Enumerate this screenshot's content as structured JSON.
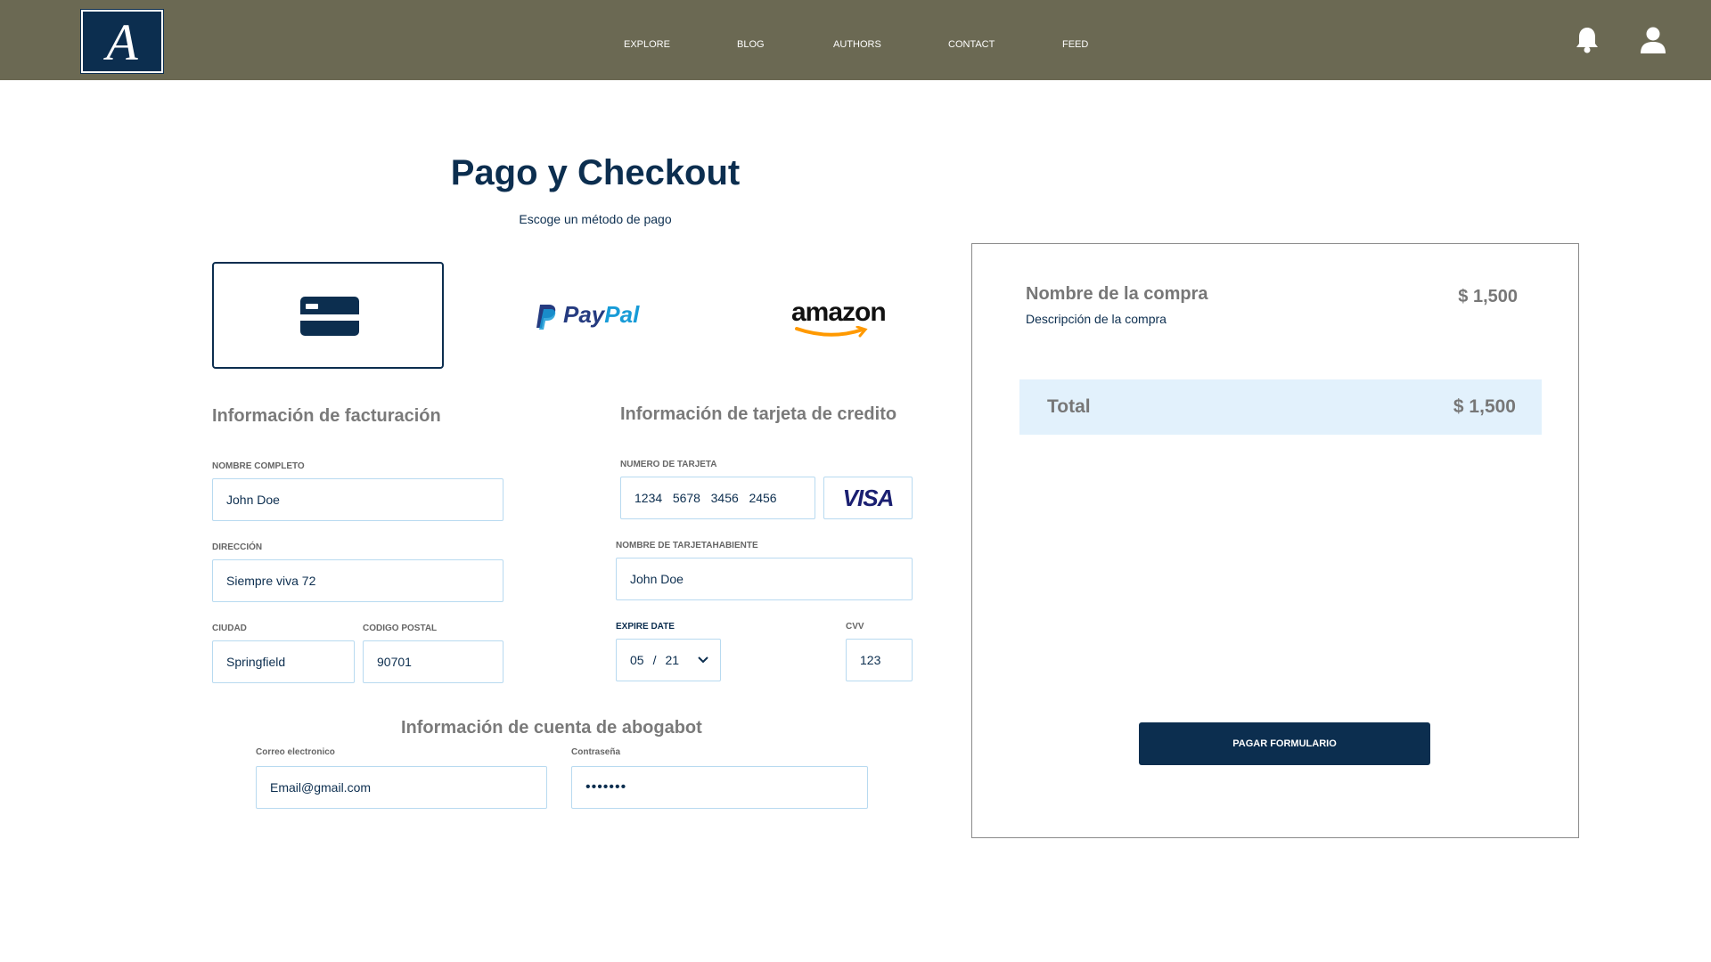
{
  "header": {
    "logo_letter": "A",
    "nav": [
      "EXPLORE",
      "BLOG",
      "AUTHORS",
      "CONTACT",
      "FEED"
    ],
    "icons": [
      "bell-icon",
      "user-icon"
    ]
  },
  "page": {
    "title": "Pago y Checkout",
    "subtitle": "Escoge un método de pago"
  },
  "payment_methods": [
    {
      "name": "credit-card",
      "icon": "credit-card-icon",
      "selected": true
    },
    {
      "name": "PayPal",
      "label_pay": "Pay",
      "label_pal": "Pal",
      "selected": false
    },
    {
      "name": "amazon",
      "label": "amazon",
      "selected": false
    }
  ],
  "billing": {
    "title": "Información de facturación",
    "name_label": "NOMBRE COMPLETO",
    "name_value": "John Doe",
    "address_label": "DIRECCIÓN",
    "address_value": "Siempre viva 72",
    "city_label": "CIUDAD",
    "city_value": "Springfield",
    "zip_label": "CODIGO POSTAL",
    "zip_value": "90701"
  },
  "card": {
    "title": "Información de tarjeta de credito",
    "number_label": "NUMERO DE TARJETA",
    "number_value": "1234   5678   3456   2456",
    "brand": "VISA",
    "holder_label": "NOMBRE DE TARJETAHABIENTE",
    "holder_value": "John Doe",
    "expire_label": "EXPIRE DATE",
    "expire_month": "05",
    "expire_sep": "/",
    "expire_year": "21",
    "cvv_label": "CVV",
    "cvv_value": "123"
  },
  "account": {
    "title": "Información de cuenta de abogabot",
    "email_label": "Correo electronico",
    "email_value": "Email@gmail.com",
    "password_label": "Contraseña",
    "password_value": "•••••••"
  },
  "summary": {
    "item_name": "Nombre de la compra",
    "item_description": "Descripción de la compra",
    "item_price": "$ 1,500",
    "total_label": "Total",
    "total_value": "$ 1,500",
    "pay_button": "PAGAR FORMULARIO"
  },
  "colors": {
    "header_bg": "#6b6953",
    "brand_navy": "#0c2e4f",
    "field_border": "#b8daf0",
    "total_bg": "#e2f1fc",
    "paypal_dark": "#253b80",
    "paypal_light": "#179bd7",
    "amazon_orange": "#ff9900"
  }
}
